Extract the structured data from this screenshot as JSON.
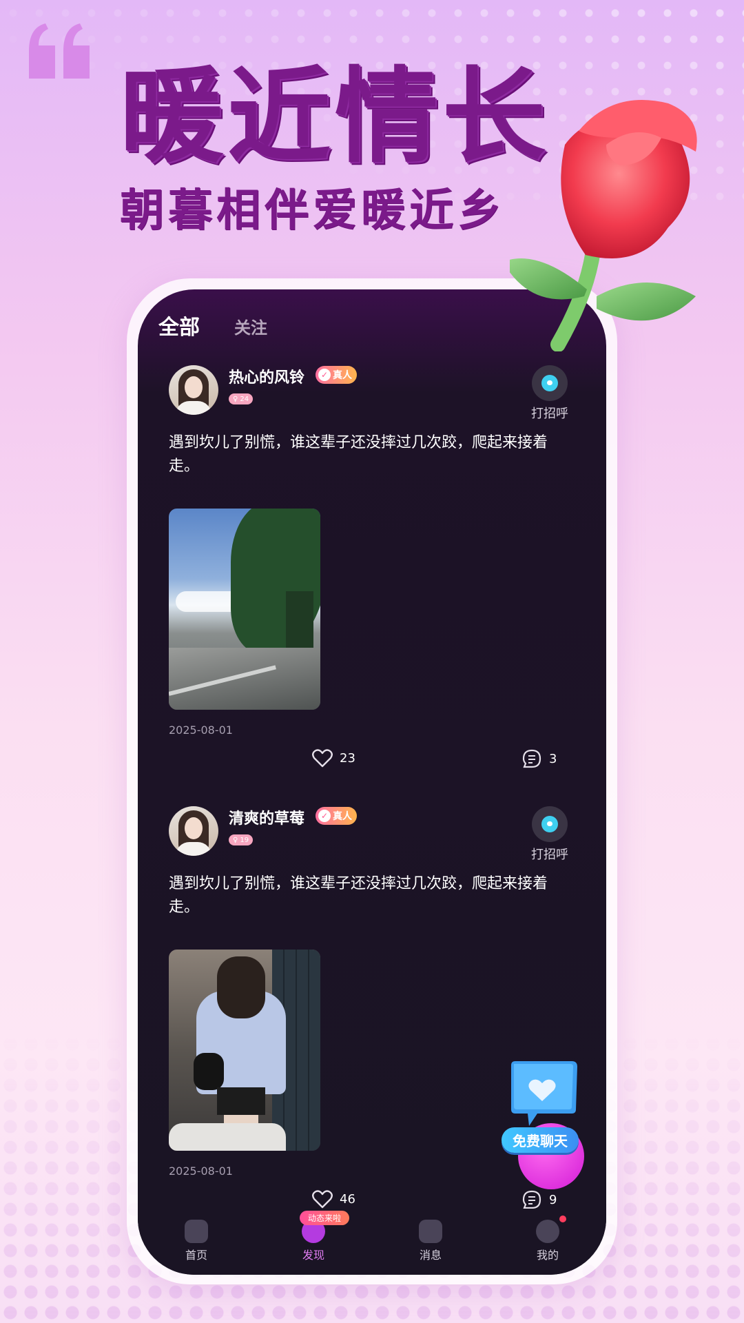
{
  "promo": {
    "headline": "暖近情长",
    "subhead": "朝暮相伴爱暖近乡"
  },
  "tabs": [
    {
      "label": "全部",
      "active": true
    },
    {
      "label": "关注",
      "active": false
    }
  ],
  "posts": [
    {
      "username": "热心的风铃",
      "badge": "真人",
      "age": "24",
      "greet_label": "打招呼",
      "content": "遇到坎儿了别慌，谁这辈子还没摔过几次跤，爬起来接着走。",
      "date": "2025-08-01",
      "likes": "23",
      "comments": "3"
    },
    {
      "username": "清爽的草莓",
      "badge": "真人",
      "age": "19",
      "greet_label": "打招呼",
      "content": "遇到坎儿了别慌，谁这辈子还没摔过几次跤，爬起来接着走。",
      "date": "2025-08-01",
      "likes": "46",
      "comments": "9"
    }
  ],
  "floating": {
    "label": "免费聊天"
  },
  "nav": {
    "pill": "动态来啦",
    "items": [
      {
        "label": "首页",
        "icon": "home-icon"
      },
      {
        "label": "发现",
        "icon": "discover-icon",
        "active": true
      },
      {
        "label": "消息",
        "icon": "message-icon"
      },
      {
        "label": "我的",
        "icon": "profile-icon"
      }
    ]
  },
  "colors": {
    "headline": "#7b1a8a",
    "phone_bg": "#1a1424",
    "badge_gradient": [
      "#ff6fa1",
      "#ffb54d"
    ],
    "accent": "#d21bd6",
    "chat_label": "#41c8ff"
  }
}
